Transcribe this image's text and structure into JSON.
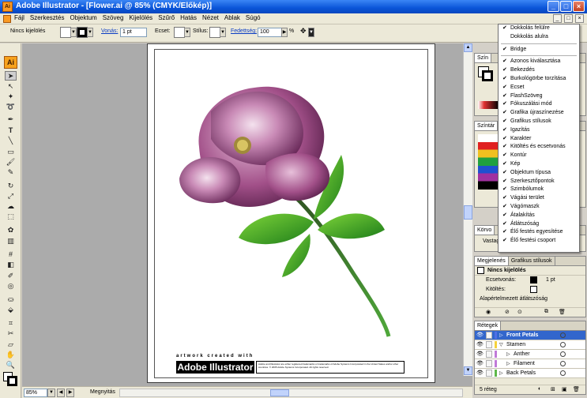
{
  "window": {
    "title": "Adobe Illustrator - [Flower.ai @ 85% (CMYK/Előkép)]",
    "buttons": {
      "minimize": "_",
      "maximize": "□",
      "close": "×"
    },
    "app_icon": "Ai"
  },
  "menubar": {
    "items": [
      "Fájl",
      "Szerkesztés",
      "Objektum",
      "Szöveg",
      "Kijelölés",
      "Szűrő",
      "Hatás",
      "Nézet",
      "Ablak",
      "Súgó"
    ]
  },
  "control": {
    "selection": "Nincs kijelölés",
    "stroke_label": "Vonás:",
    "stroke_value": "1 pt",
    "brush_label": "Ecset:",
    "style_label": "Stílus:",
    "opacity_label": "Fedettség:",
    "opacity_value": "100",
    "opacity_unit": "%"
  },
  "toolbox": {
    "logo": "Ai"
  },
  "artboard": {
    "credit": "artwork created with",
    "logo": "Adobe Illustrator",
    "legal": "Adobe and Illustrator are either registered trademarks or trademarks of Adobe Systems Incorporated in the United States and/or other countries. © 2005 Adobe Systems Incorporated. All rights reserved."
  },
  "status": {
    "zoom": "85%",
    "state": "Megnyitás"
  },
  "panels": {
    "color_tab": "Szín",
    "swatch_tab": "Színtár",
    "appearance_tab": "Megjelenés",
    "graphic_styles_tab": "Grafikus stílusok",
    "corner_tab": "Körvo",
    "corner_row": "Vastag",
    "appearance": {
      "title": "Nincs kijelölés",
      "stroke_label": "Ecsetvonás:",
      "stroke_value": "1 pt",
      "fill_label": "Kitöltés:",
      "opacity_label": "Alapértelmezett átlátszóság"
    },
    "layers_tab": "Rétegek",
    "layers": [
      {
        "name": "Front Petals",
        "level": 0,
        "color": "#4f6fe6"
      },
      {
        "name": "Stamen",
        "level": 0,
        "color": "#f5d23d"
      },
      {
        "name": "Anther",
        "level": 1,
        "color": "#c07ad8"
      },
      {
        "name": "Filament",
        "level": 1,
        "color": "#c07ad8"
      },
      {
        "name": "Back Petals",
        "level": 0,
        "color": "#5fb84a"
      }
    ],
    "layers_count": "5 réteg"
  },
  "context_menu": {
    "top": [
      {
        "label": "Dokkolás felülre",
        "checked": true
      },
      {
        "label": "Dokkolás alulra",
        "checked": false
      }
    ],
    "middle": [
      {
        "label": "Bridge",
        "checked": true
      }
    ],
    "bottom": [
      {
        "label": "Azonos kiválasztása",
        "checked": true
      },
      {
        "label": "Bekezdés",
        "checked": true
      },
      {
        "label": "Burkológörbe torzítása",
        "checked": true
      },
      {
        "label": "Ecset",
        "checked": true
      },
      {
        "label": "FlashSzöveg",
        "checked": true
      },
      {
        "label": "Fókuszálási mód",
        "checked": true
      },
      {
        "label": "Grafika újraszínezése",
        "checked": true
      },
      {
        "label": "Grafikus stílusok",
        "checked": true
      },
      {
        "label": "Igazítás",
        "checked": true
      },
      {
        "label": "Karakter",
        "checked": true
      },
      {
        "label": "Kitöltés és ecsetvonás",
        "checked": true
      },
      {
        "label": "Kontúr",
        "checked": true
      },
      {
        "label": "Kép",
        "checked": true
      },
      {
        "label": "Objektum típusa",
        "checked": true
      },
      {
        "label": "Szerkesztőpontok",
        "checked": true
      },
      {
        "label": "Szimbólumok",
        "checked": true
      },
      {
        "label": "Vágási terület",
        "checked": true
      },
      {
        "label": "Vágómaszk",
        "checked": true
      },
      {
        "label": "Átalakítás",
        "checked": true
      },
      {
        "label": "Átlátszóság",
        "checked": true
      },
      {
        "label": "Élő festés egyesítése",
        "checked": true
      },
      {
        "label": "Élő festési csoport",
        "checked": true
      }
    ]
  }
}
